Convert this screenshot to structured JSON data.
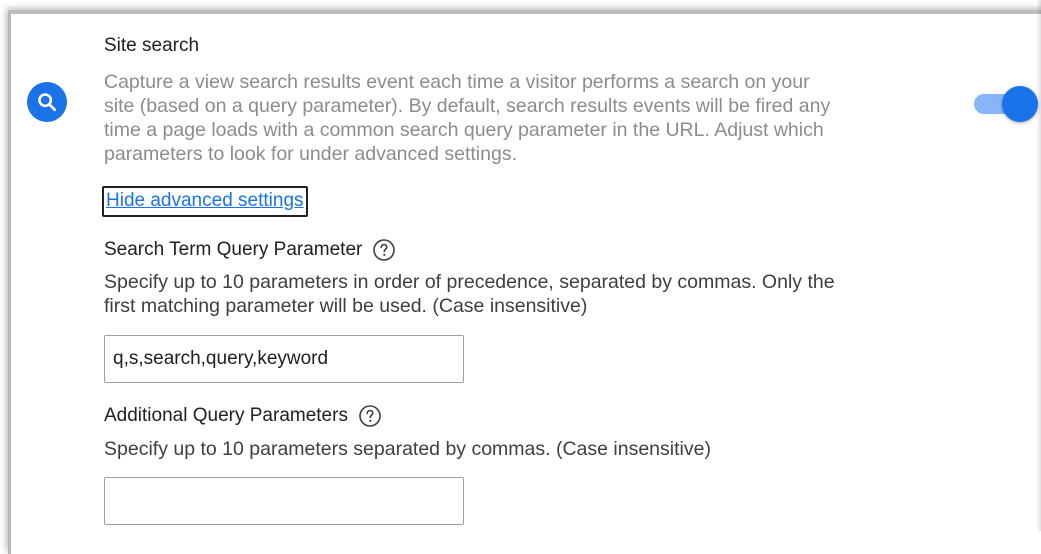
{
  "site_search": {
    "icon": "search-icon",
    "title": "Site search",
    "description_lines": [
      "Capture a view search results event each time a visitor performs a search on your",
      "site (based on a query parameter). By default, search results events will be fired any",
      "time a page loads with a common search query parameter in the URL. Adjust which",
      "parameters to look for under advanced settings."
    ],
    "toggle_on": true,
    "advanced_link": "Hide advanced settings"
  },
  "search_term": {
    "title": "Search Term Query Parameter",
    "help_icon": "help-circle-icon",
    "description_lines": [
      "Specify up to 10 parameters in order of precedence, separated by commas. Only the",
      "first matching parameter will be used. (Case insensitive)"
    ],
    "value": "q,s,search,query,keyword"
  },
  "additional": {
    "title": "Additional Query Parameters",
    "help_icon": "help-circle-icon",
    "description": "Specify up to 10 parameters separated by commas. (Case insensitive)",
    "value": ""
  },
  "colors": {
    "accent": "#1a73e8",
    "toggle_track": "#8ab4f8",
    "muted_text": "#8c8c8c"
  }
}
